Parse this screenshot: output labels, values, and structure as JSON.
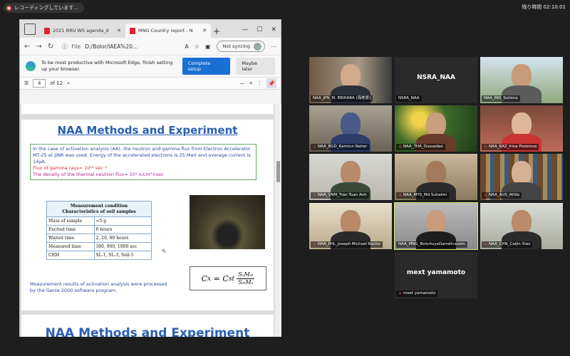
{
  "recording": {
    "label": "レコーディングしています..."
  },
  "remaining": {
    "label": "残り時間",
    "time": "02:10:01"
  },
  "browser": {
    "tabs": [
      {
        "title": "2021 RRU WS agenda_d",
        "active": false
      },
      {
        "title": "MNG Country report - N",
        "active": true
      }
    ],
    "address": {
      "prefix": "File",
      "url": "D:/Bolor/IAEA%20..."
    },
    "sync": "Not syncing",
    "banner": {
      "message": "To be most productive with Microsoft Edge, finish setting up your browser.",
      "primary": "Complete setup",
      "secondary": "Maybe later"
    },
    "pdf": {
      "page": "4",
      "of": "of 12"
    }
  },
  "slide": {
    "title": "NAA Methods and Experiment",
    "para": "In the case of activation analysis (AA), the neutron and gamma flux from Electron Accelerator MT-25 at JINR was used.   Energy of the accelerated electrons is 25 MeV and average current is 14μA.",
    "flux_gamma": "Flux of gamma rays= 10¹⁴ sec⁻¹",
    "flux_neutron": "The density of the thermal neutron flux= 10⁹ n/cm²×sec",
    "table_header_1": "Measurement condition",
    "table_header_2": "Characteristics of  soil  samples",
    "table": [
      [
        "Mass of sample",
        "≈5 g"
      ],
      [
        "Excited time",
        "6 hours"
      ],
      [
        "Waited time",
        "2, 20, 80 hours"
      ],
      [
        "Measured time",
        "300, 900, 1800 sec"
      ],
      [
        "CRM",
        "SL-1, SL-3, Soil-5"
      ]
    ],
    "caption": "Measurement results of activation analysis were processed by the Genie 2000 software program.",
    "formula": {
      "lhs": "C",
      "lhs_sub": "x",
      "c": "C",
      "c_sub": "st",
      "num": "SₓMₛₜ",
      "den": "SₛₜMₓ"
    },
    "title2": "NAA Methods and Experiment"
  },
  "participants": [
    {
      "name": "NAA_JPN_M. EBIHARA (海老原)",
      "muted": false
    },
    {
      "name": "NSRA_NAA",
      "muted": false,
      "display": "NSRA_NAA"
    },
    {
      "name": "NAA_IND_Sutisna",
      "muted": false
    },
    {
      "name": "NAA_BGD_Kamrun Naher",
      "muted": true
    },
    {
      "name": "NAA_THA_Dussadee",
      "muted": true
    },
    {
      "name": "NAA_KAZ_Irina Pozorova",
      "muted": true
    },
    {
      "name": "NAA_VNM_Tran Tuan Anh",
      "muted": true
    },
    {
      "name": "NAA_MYS_Md Suhaimi",
      "muted": true
    },
    {
      "name": "NAA_AUS_Attila",
      "muted": true
    },
    {
      "name": "NAA_PHL_Joseph Michael Racho",
      "muted": true
    },
    {
      "name": "NAA_MNG_BolortuyaDamdinsuren",
      "muted": false
    },
    {
      "name": "NAA_CHN_Caijin Xiao",
      "muted": true
    },
    {
      "name": "mext yamamoto",
      "muted": true,
      "display": "mext yamamoto"
    }
  ]
}
